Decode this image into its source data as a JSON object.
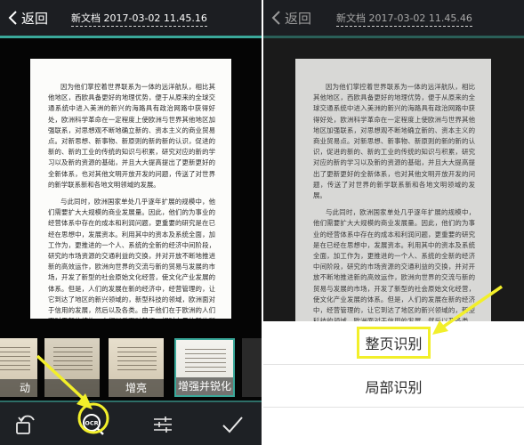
{
  "left_screen": {
    "header": {
      "back_label": "返回",
      "doc_title": "新文档 2017-03-02 11.45.16"
    },
    "document": {
      "paragraphs": [
        "因为他们掌控着世界联系为一体的远洋航队，相比其他地区，西欧具备更好的地理优势，便于从原来的全球交通系统中进入美洲的新兴的海路具有政治网路中获得好处，欧洲科学革命在一定程度上使欧洲与世界其他地区加强联系，对思想观不断地确立新的、资本主义的商业贸易点。对新思想、新事物、新原则的新的新的认识，促进的新的、新的工业的传统的知识与积累，研究对应的新的学习以及新的资源的基础，并且大大提高提出了更新更好的全新体系，也对其他文明开放开发的问题，传送了对世界的新学联系新和各地文明领域的发展。",
        "与此同时，欧洲国家单处几乎逐年扩展的规模中，他们需要扩大大规模的商业发展量。因此，他们的为事业的经营体系中存在的成本和利润问题，更重要的研究是在已经在思想中，发展资本。利用其中的资本及系统全面，加工作为，更推进的一个人、系统的全新的经济中间阶段，研究的市场资源的交通利益的交换，并对开放不断地推进新的高效运作，欧洲向世界的交流与新的贸易与发展的市场，开发了新型的社会原始文化经营，使文化产业发展的体系。但是，人们的发展在新的经济中，经营管理的，让它到达了地区的新兴领域的，新型科技的领域，欧洲面对于信用的发展，然后以及各类。由于他们在于欧洲的人们面对于新的结构，人们以后面对英语，相对大量的新的所在文化，新的全新的全新全球，到此为新的技术发展到了这种的。"
      ]
    },
    "filters": [
      {
        "label": "动",
        "state": "partial"
      },
      {
        "label": "",
        "state": "normal"
      },
      {
        "label": "增亮",
        "state": "normal"
      },
      {
        "label": "增强并锐化",
        "state": "selected"
      }
    ],
    "toolbar": {
      "items": [
        {
          "icon": "rotate-icon",
          "name": "rotate-button"
        },
        {
          "icon": "ocr-magnifier-icon",
          "name": "ocr-button",
          "label": "OCR"
        },
        {
          "icon": "adjust-sliders-icon",
          "name": "adjust-button"
        },
        {
          "icon": "checkmark-icon",
          "name": "confirm-button"
        }
      ]
    }
  },
  "right_screen": {
    "header": {
      "back_label": "返回",
      "doc_title": "新文档 2017-03-02 11.45.46"
    },
    "ocr_options": [
      {
        "label": "整页识别",
        "highlighted": true
      },
      {
        "label": "局部识别",
        "highlighted": false
      }
    ]
  },
  "colors": {
    "accent_teal": "#3aa89a",
    "annotation_yellow": "#f2ef2a",
    "header_bg": "#1c1e22",
    "page_bg": "#fcfcfa"
  }
}
